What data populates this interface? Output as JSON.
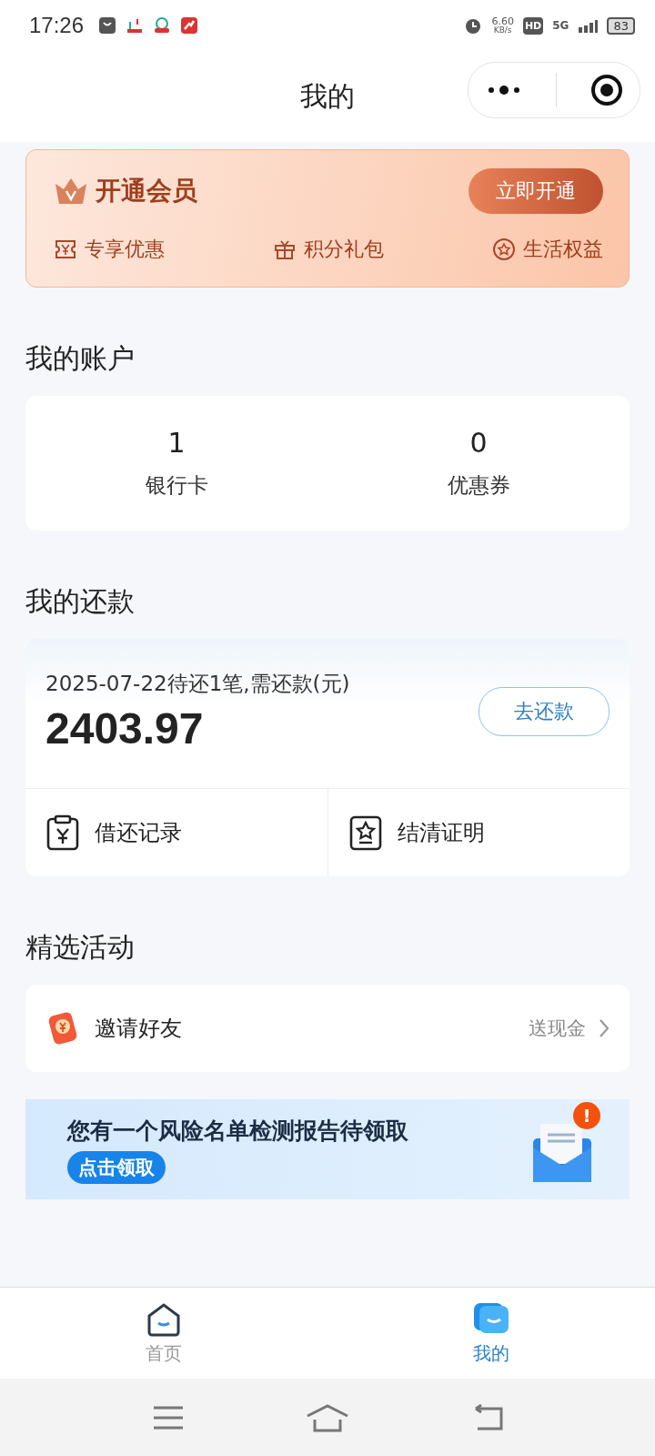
{
  "status_bar": {
    "time": "17:26",
    "speed": "6.60",
    "speed_unit": "KB/s",
    "hd": "HD",
    "network": "5G",
    "battery": "83"
  },
  "nav": {
    "title": "我的"
  },
  "member": {
    "title": "开通会员",
    "button": "立即开通",
    "perks": [
      "专享优惠",
      "积分礼包",
      "生活权益"
    ]
  },
  "account": {
    "heading": "我的账户",
    "stats": [
      {
        "value": "1",
        "label": "银行卡"
      },
      {
        "value": "0",
        "label": "优惠券"
      }
    ]
  },
  "repay": {
    "heading": "我的还款",
    "due": "2025-07-22待还1笔,需还款(元)",
    "amount": "2403.97",
    "button": "去还款",
    "links": [
      "借还记录",
      "结清证明"
    ]
  },
  "activities": {
    "heading": "精选活动",
    "items": [
      {
        "title": "邀请好友",
        "hint": "送现金"
      }
    ]
  },
  "banner": {
    "title": "您有一个风险名单检测报告待领取",
    "button": "点击领取",
    "alert": "!"
  },
  "tabs": [
    {
      "label": "首页",
      "selected": false
    },
    {
      "label": "我的",
      "selected": true
    }
  ]
}
